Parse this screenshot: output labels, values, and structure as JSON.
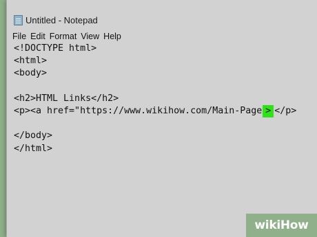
{
  "window": {
    "title": "Untitled - Notepad",
    "app_icon": "notepad-icon"
  },
  "menu": {
    "items": [
      "File",
      "Edit",
      "Format",
      "View",
      "Help"
    ]
  },
  "editor": {
    "lines": [
      "<!DOCTYPE html>",
      "<html>",
      "<body>",
      "",
      "<h2>HTML Links</h2>",
      {
        "before": "<p><a href=\"https://www.wikihow.com/Main-Page",
        "highlight": ">",
        "after": "</p>"
      },
      "",
      "</body>",
      "</html>"
    ]
  },
  "watermark": {
    "text": "wikiHow"
  },
  "colors": {
    "background": "#8fb08a",
    "window": "#d2d2d2",
    "highlight": "#2fe01a"
  }
}
